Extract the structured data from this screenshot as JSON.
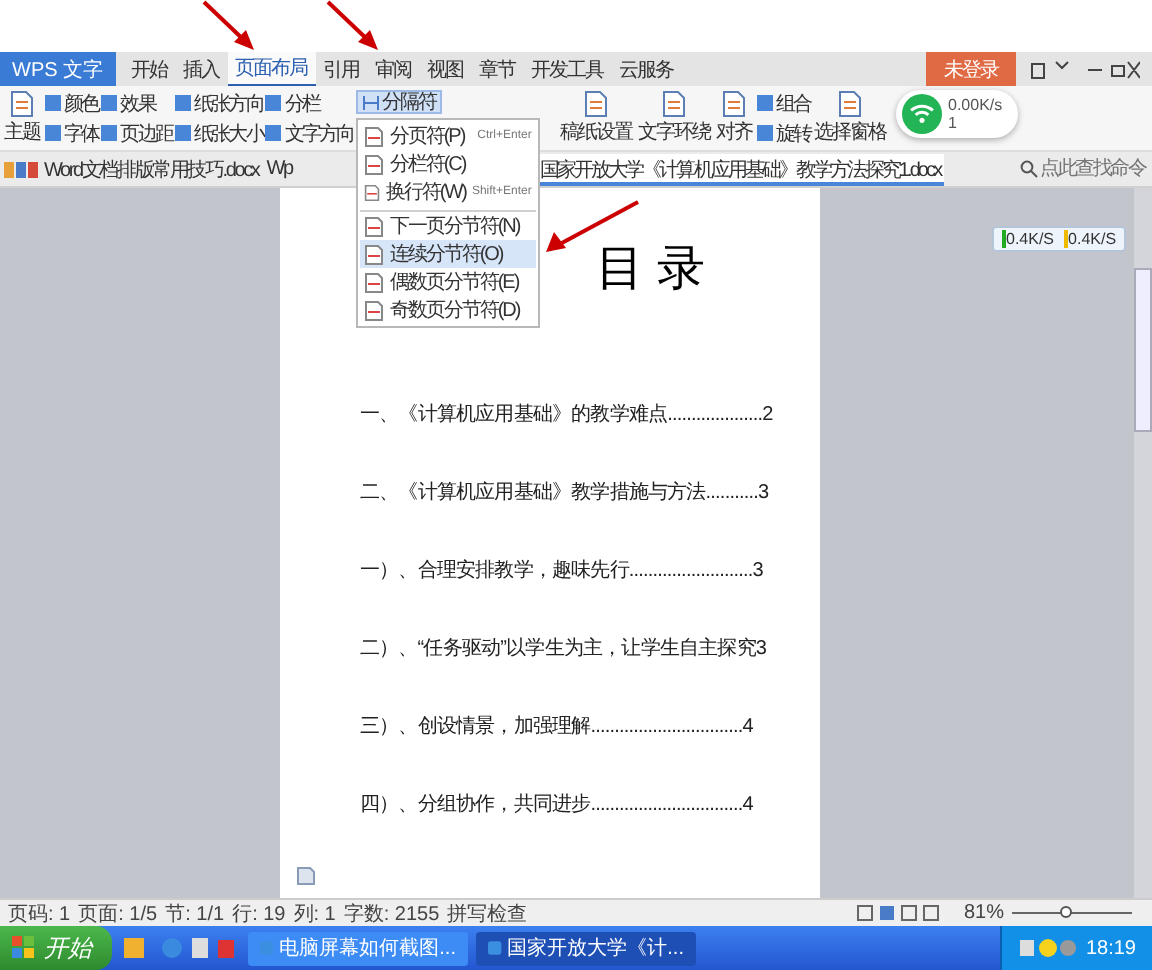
{
  "app_button": {
    "label": "WPS 文字"
  },
  "menu_tabs": [
    {
      "label": "开始",
      "selected": false
    },
    {
      "label": "插入",
      "selected": false
    },
    {
      "label": "页面布局",
      "selected": true
    },
    {
      "label": "引用",
      "selected": false
    },
    {
      "label": "审阅",
      "selected": false
    },
    {
      "label": "视图",
      "selected": false
    },
    {
      "label": "章节",
      "selected": false
    },
    {
      "label": "开发工具",
      "selected": false
    },
    {
      "label": "云服务",
      "selected": false
    }
  ],
  "login_button": {
    "label": "未登录"
  },
  "ribbon": [
    {
      "kind": "large",
      "label": "主题"
    },
    {
      "kind": "stack",
      "items": [
        {
          "label": "颜色"
        },
        {
          "label": "字体"
        }
      ]
    },
    {
      "kind": "stack",
      "items": [
        {
          "label": "效果"
        },
        {
          "label": "页边距"
        }
      ]
    },
    {
      "kind": "stack",
      "items": [
        {
          "label": "纸张方向"
        },
        {
          "label": "纸张大小"
        }
      ]
    },
    {
      "kind": "stack",
      "items": [
        {
          "label": "分栏"
        },
        {
          "label": "文字方向"
        }
      ]
    },
    {
      "kind": "menu",
      "label": "分隔符",
      "open": true
    },
    {
      "kind": "large",
      "label": "稿纸设置"
    },
    {
      "kind": "large",
      "label": "文字环绕"
    },
    {
      "kind": "large",
      "label": "对齐"
    },
    {
      "kind": "stack",
      "items": [
        {
          "label": "组合"
        },
        {
          "label": "旋转"
        }
      ]
    },
    {
      "kind": "large",
      "label": "选择窗格"
    }
  ],
  "network_widget": {
    "speed": "0.00K/s",
    "count": "1"
  },
  "doc_tabs": [
    {
      "label": "Word文档排版常用技巧.docx",
      "selected": false
    },
    {
      "label": "Wp",
      "selected": false
    },
    {
      "label": "国家开放大学《计算机应用基础》教学方法探究1.docx",
      "selected": true
    }
  ],
  "command_search": {
    "placeholder": "点此查找命令"
  },
  "separator_menu": [
    {
      "label": "分页符(P)",
      "shortcut": "Ctrl+Enter",
      "selected": false,
      "group_start": false
    },
    {
      "label": "分栏符(C)",
      "selected": false,
      "group_start": false
    },
    {
      "label": "换行符(W)",
      "shortcut": "Shift+Enter",
      "selected": false,
      "group_start": false
    },
    {
      "label": "下一页分节符(N)",
      "selected": false,
      "group_start": true
    },
    {
      "label": "连续分节符(O)",
      "selected": true,
      "group_start": false
    },
    {
      "label": "偶数页分节符(E)",
      "selected": false,
      "group_start": false
    },
    {
      "label": "奇数页分节符(D)",
      "selected": false,
      "group_start": false
    }
  ],
  "document": {
    "title": "目 录",
    "toc": [
      "一、《计算机应用基础》的教学难点....................2",
      "二、《计算机应用基础》教学措施与方法...........3",
      "一）、合理安排教学，趣味先行..........................3",
      "二）、“任务驱动”以学生为主，让学生自主探究3",
      "三）、创设情景，加强理解................................4",
      "四）、分组协作，共同进步................................4"
    ]
  },
  "speed_widget": {
    "download": "0.4K/S",
    "upload": "0.4K/S"
  },
  "status_bar": {
    "items": [
      "页码: 1",
      "页面: 1/5",
      "节: 1/1",
      "行: 19",
      "列: 1",
      "字数: 2155",
      "拼写检查"
    ],
    "zoom": "81%",
    "zoom_slider": {
      "level": 0.45
    }
  },
  "taskbar": {
    "start": "开始",
    "windows": [
      {
        "label": "电脑屏幕如何截图...",
        "selected": false
      },
      {
        "label": "国家开放大学《计...",
        "selected": true
      }
    ],
    "clock": "18:19"
  }
}
